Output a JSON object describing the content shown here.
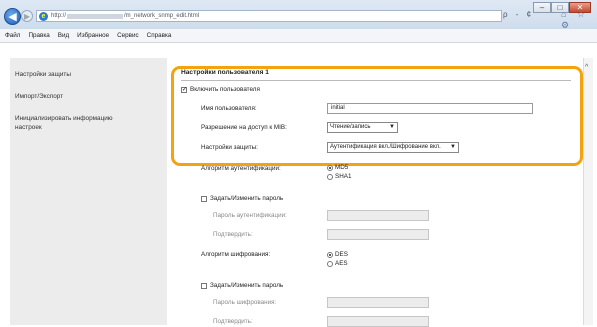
{
  "browser": {
    "url_prefix": "http://",
    "url_suffix": "/m_network_snmp_edit.html",
    "addr_tools": "ρ - ¢",
    "right_icons": "⌂ ☆ ⚙",
    "window_controls": [
      "–",
      "□",
      "✕"
    ]
  },
  "menubar": [
    "Файл",
    "Правка",
    "Вид",
    "Избранное",
    "Сервис",
    "Справка"
  ],
  "sidebar": {
    "items": [
      "Настройки защиты",
      "Импорт/Экспорт",
      "Инициализировать информацию настроек"
    ]
  },
  "main": {
    "section_title": "Настройки пользователя 1",
    "enable_user_label": "Включить пользователя",
    "enable_user_checked": true,
    "username_label": "Имя пользователя:",
    "username_value": "initial",
    "mib_access_label": "Разрешение на доступ к MIB:",
    "mib_access_value": "Чтение/запись",
    "security_label": "Настройки защиты:",
    "security_value": "Аутентификация вкл./Шифрование вкл.",
    "auth_algo_label": "Алгоритм аутентификации:",
    "auth_algo_options": [
      "MD5",
      "SHA1"
    ],
    "auth_algo_selected": "MD5",
    "set_auth_pw_label": "Задать/Изменить пароль",
    "auth_pw_label": "Пароль аутентификации:",
    "confirm_label": "Подтвердить:",
    "enc_algo_label": "Алгоритм шифрования:",
    "enc_algo_options": [
      "DES",
      "AES"
    ],
    "enc_algo_selected": "DES",
    "set_enc_pw_label": "Задать/Изменить пароль",
    "enc_pw_label": "Пароль шифрования:",
    "enc_confirm_label": "Подтвердить:"
  },
  "colors": {
    "highlight": "#f2a30f",
    "sidebar_bg": "#ececec"
  }
}
